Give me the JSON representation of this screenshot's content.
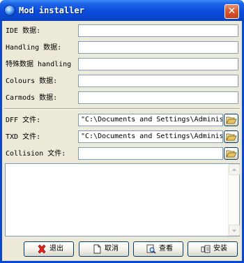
{
  "window": {
    "title": "Mod installer",
    "close_glyph": "✕",
    "app_icon": "globe-icon"
  },
  "form": {
    "ide_label": "IDE 数据:",
    "handling_label": "Handling 数据:",
    "special_handling_label": "特殊数据 handling",
    "colours_label": "Colours 数据:",
    "carmods_label": "Carmods 数据:",
    "ide_value": "",
    "handling_value": "",
    "special_handling_value": "",
    "colours_value": "",
    "carmods_value": ""
  },
  "files": {
    "dff_label": "DFF 文件:",
    "dff_value": "\"C:\\Documents and Settings\\Adminis",
    "txd_label": "TXD 文件:",
    "txd_value": "\"C:\\Documents and Settings\\Adminis",
    "collision_label": "Collision 文件:",
    "collision_value": "",
    "browse_icon": "open-folder-icon"
  },
  "log": {
    "text": ""
  },
  "buttons": {
    "exit_label": "退出",
    "cancel_label": "取消",
    "view_label": "查看",
    "install_label": "安装"
  }
}
